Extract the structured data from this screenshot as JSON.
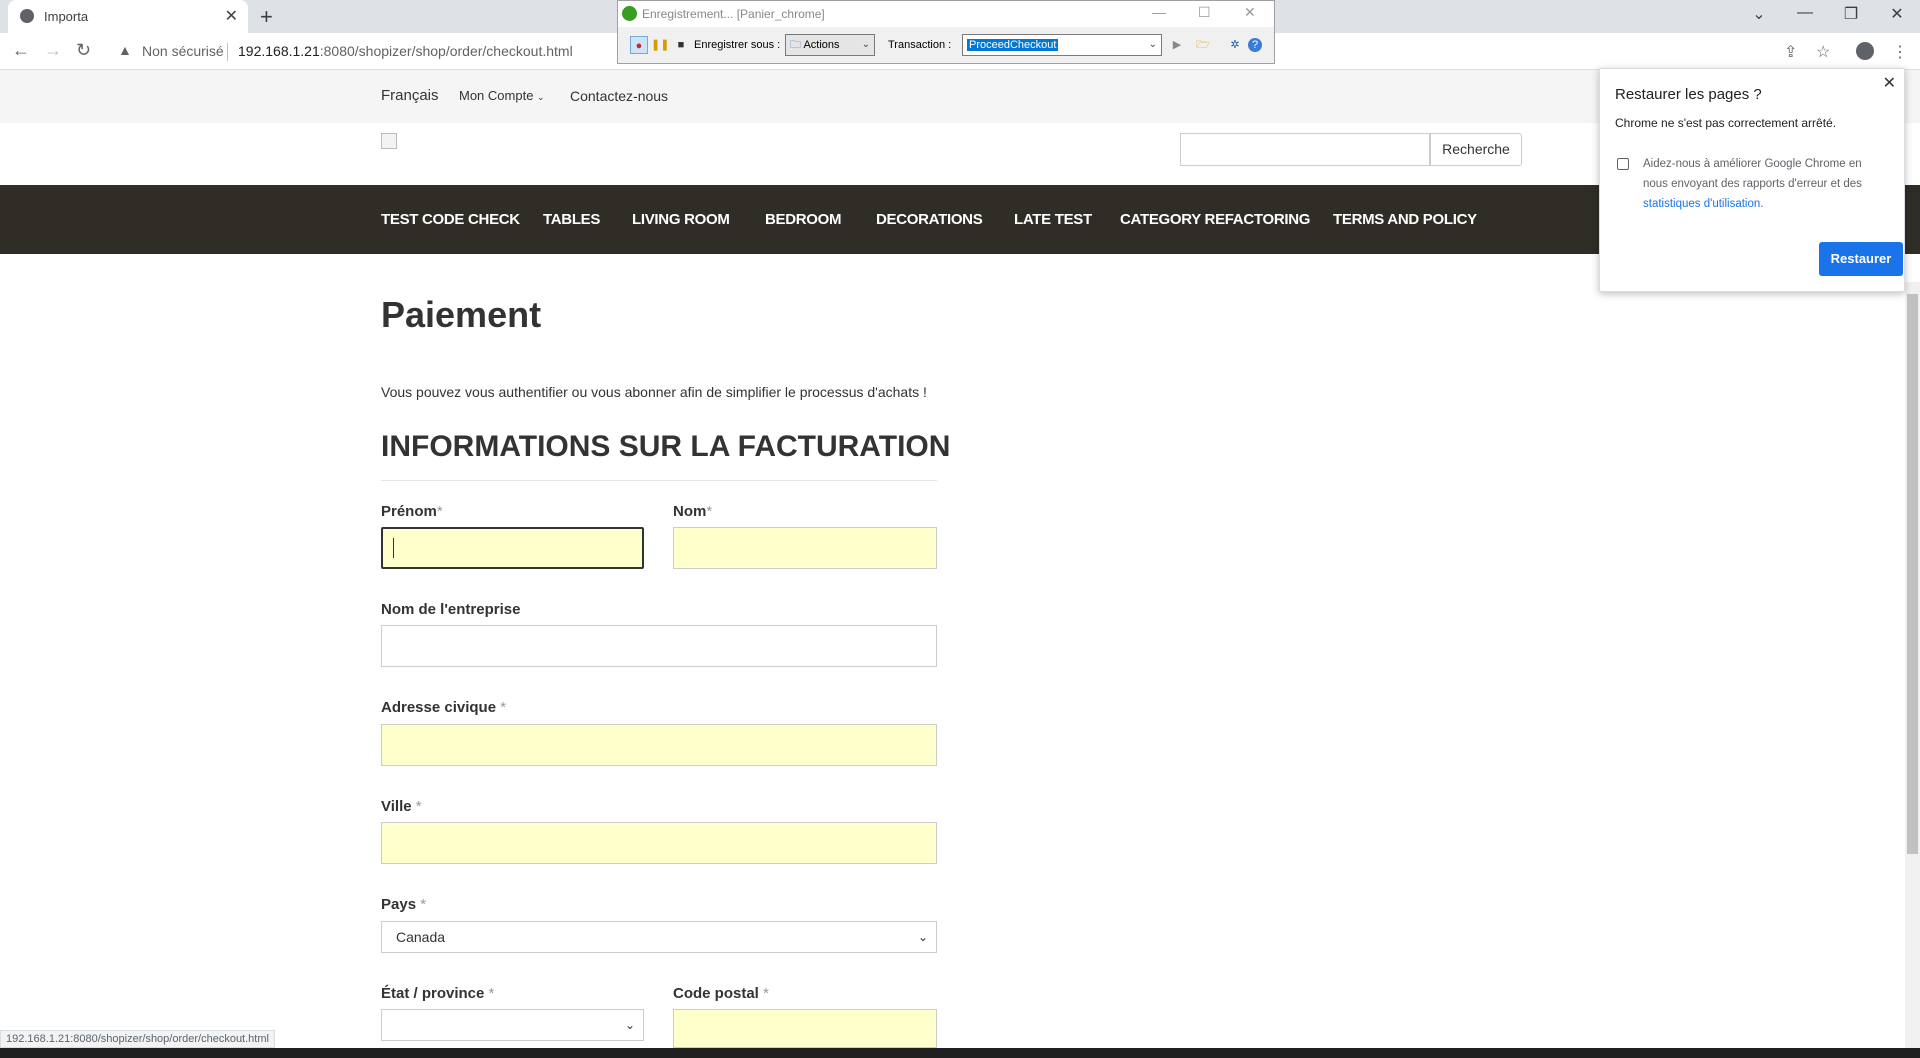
{
  "browser": {
    "tab_title": "Importa",
    "new_tab": "+",
    "security_label": "Non sécurisé",
    "url_host": "192.168.1.21",
    "url_rest": ":8080/shopizer/shop/order/checkout.html",
    "status_url": "192.168.1.21:8080/shopizer/shop/order/checkout.html"
  },
  "recorder": {
    "title": "Enregistrement... [Panier_chrome]",
    "save_label": "Enregistrer sous :",
    "save_value": "Actions",
    "transaction_label": "Transaction :",
    "transaction_value": "ProceedCheckout"
  },
  "topnav": {
    "language": "Français",
    "account": "Mon Compte",
    "contact": "Contactez-nous"
  },
  "search": {
    "placeholder": "",
    "button": "Recherche"
  },
  "categories": [
    "TEST CODE CHECK",
    "TABLES",
    "LIVING ROOM",
    "BEDROOM",
    "DECORATIONS",
    "LATE TEST",
    "CATEGORY REFACTORING",
    "TERMS AND POLICY"
  ],
  "main": {
    "title": "Paiement",
    "intro": "Vous pouvez vous authentifier ou vous abonner afin de simplifier le processus d'achats !",
    "billing_title": "INFORMATIONS SUR LA FACTURATION",
    "fields": {
      "firstname": "Prénom",
      "lastname": "Nom",
      "company": "Nom de l'entreprise",
      "address": "Adresse civique",
      "city": "Ville",
      "country": "Pays",
      "country_value": "Canada",
      "state": "État / province",
      "postal": "Code postal"
    },
    "required_mark": "*"
  },
  "restore_popup": {
    "title": "Restaurer les pages ?",
    "description": "Chrome ne s'est pas correctement arrêté.",
    "help_text": "Aidez-nous à améliorer Google Chrome en nous envoyant des rapports d'erreur et des",
    "help_link": "statistiques d'utilisation.",
    "button": "Restaurer"
  },
  "colors": {
    "category_bar": "#302d27",
    "required_field": "#ffffcc",
    "restore_button": "#1a73e8"
  }
}
